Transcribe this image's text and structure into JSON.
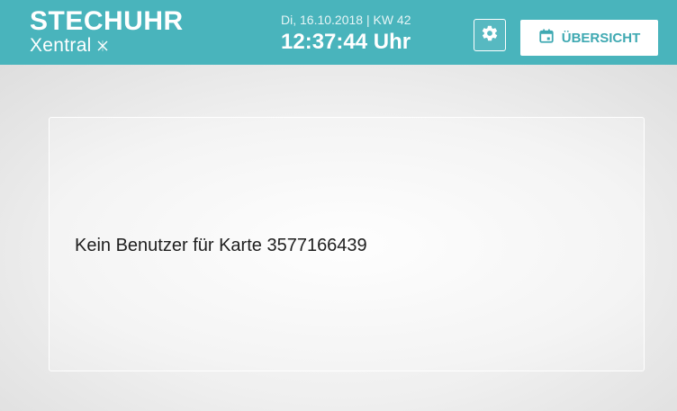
{
  "header": {
    "title": "STECHUHR",
    "brand": "Xentral",
    "brand_icon": "xentral-x-icon",
    "date_line": "Di, 16.10.2018 | KW 42",
    "time": "12:37:44 Uhr",
    "settings_icon": "gear-icon",
    "overview_label": "ÜBERSICHT",
    "overview_icon": "calendar-icon",
    "background_color": "#49b4bc"
  },
  "message": {
    "text": "Kein Benutzer für Karte 3577166439"
  }
}
